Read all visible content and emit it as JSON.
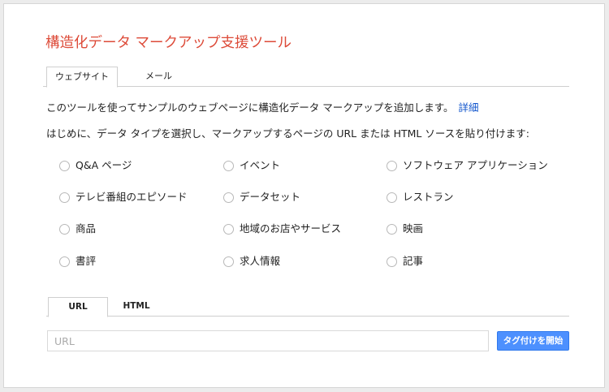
{
  "title": "構造化データ マークアップ支援ツール",
  "tabs": [
    "ウェブサイト",
    "メール"
  ],
  "intro": {
    "text": "このツールを使ってサンプルのウェブページに構造化データ マークアップを追加します。",
    "link": "詳細"
  },
  "instruction": "はじめに、データ タイプを選択し、マークアップするページの URL または HTML ソースを貼り付けます:",
  "data_types": [
    "Q&A ページ",
    "イベント",
    "ソフトウェア アプリケーション",
    "テレビ番組のエピソード",
    "データセット",
    "レストラン",
    "商品",
    "地域のお店やサービス",
    "映画",
    "書評",
    "求人情報",
    "記事"
  ],
  "source_tabs": [
    "URL",
    "HTML"
  ],
  "url_input": {
    "placeholder": "URL",
    "value": ""
  },
  "start_button": "タグ付けを開始"
}
